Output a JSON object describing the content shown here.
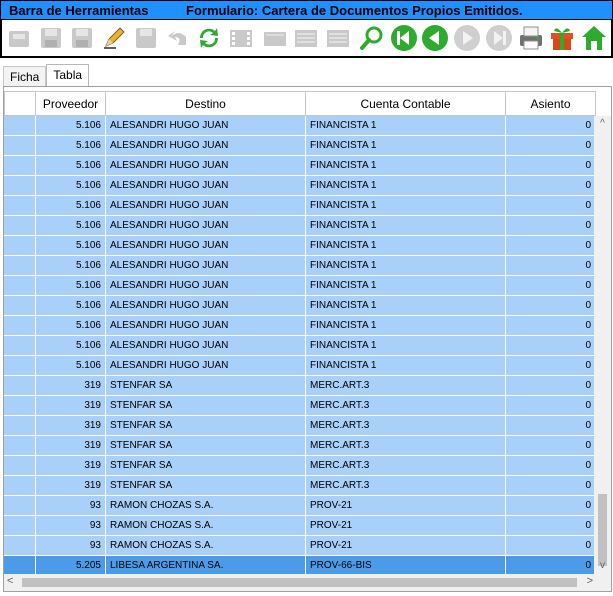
{
  "titlebar": {
    "left": "Barra de Herramientas",
    "right": "Formulario: Cartera de Documentos Propios Emitidos."
  },
  "toolbar": {
    "buttons": [
      {
        "icon": "new-icon",
        "enabled": false
      },
      {
        "icon": "save-icon",
        "enabled": false
      },
      {
        "icon": "save-as-icon",
        "enabled": false
      },
      {
        "icon": "edit-pencil-icon",
        "enabled": true
      },
      {
        "icon": "save-copy-icon",
        "enabled": false
      },
      {
        "icon": "undo-icon",
        "enabled": false
      },
      {
        "icon": "refresh-icon",
        "enabled": true
      },
      {
        "icon": "film-icon",
        "enabled": false
      },
      {
        "icon": "card-icon",
        "enabled": false
      },
      {
        "icon": "list-icon",
        "enabled": false
      },
      {
        "icon": "list2-icon",
        "enabled": false
      },
      {
        "icon": "search-icon",
        "enabled": true
      },
      {
        "icon": "first-record-icon",
        "enabled": true
      },
      {
        "icon": "previous-record-icon",
        "enabled": true
      },
      {
        "icon": "next-record-icon",
        "enabled": false
      },
      {
        "icon": "last-record-icon",
        "enabled": false
      },
      {
        "icon": "print-icon",
        "enabled": true
      },
      {
        "icon": "gift-icon",
        "enabled": true
      },
      {
        "icon": "home-icon",
        "enabled": true
      }
    ]
  },
  "tabs": [
    {
      "label": "Ficha",
      "active": false
    },
    {
      "label": "Tabla",
      "active": true
    }
  ],
  "table": {
    "columns": [
      "",
      "Proveedor",
      "Destino",
      "Cuenta Contable",
      "Asiento"
    ],
    "rows": [
      [
        "5.106",
        "ALESANDRI HUGO JUAN",
        "FINANCISTA 1",
        "0"
      ],
      [
        "5.106",
        "ALESANDRI HUGO JUAN",
        "FINANCISTA 1",
        "0"
      ],
      [
        "5.106",
        "ALESANDRI HUGO JUAN",
        "FINANCISTA 1",
        "0"
      ],
      [
        "5.106",
        "ALESANDRI HUGO JUAN",
        "FINANCISTA 1",
        "0"
      ],
      [
        "5.106",
        "ALESANDRI HUGO JUAN",
        "FINANCISTA 1",
        "0"
      ],
      [
        "5.106",
        "ALESANDRI HUGO JUAN",
        "FINANCISTA 1",
        "0"
      ],
      [
        "5.106",
        "ALESANDRI HUGO JUAN",
        "FINANCISTA 1",
        "0"
      ],
      [
        "5.106",
        "ALESANDRI HUGO JUAN",
        "FINANCISTA 1",
        "0"
      ],
      [
        "5.106",
        "ALESANDRI HUGO JUAN",
        "FINANCISTA 1",
        "0"
      ],
      [
        "5.106",
        "ALESANDRI HUGO JUAN",
        "FINANCISTA 1",
        "0"
      ],
      [
        "5.106",
        "ALESANDRI HUGO JUAN",
        "FINANCISTA 1",
        "0"
      ],
      [
        "5.106",
        "ALESANDRI HUGO JUAN",
        "FINANCISTA 1",
        "0"
      ],
      [
        "5.106",
        "ALESANDRI HUGO JUAN",
        "FINANCISTA 1",
        "0"
      ],
      [
        "319",
        "STENFAR SA",
        "MERC.ART.3",
        "0"
      ],
      [
        "319",
        "STENFAR SA",
        "MERC.ART.3",
        "0"
      ],
      [
        "319",
        "STENFAR SA",
        "MERC.ART.3",
        "0"
      ],
      [
        "319",
        "STENFAR SA",
        "MERC.ART.3",
        "0"
      ],
      [
        "319",
        "STENFAR SA",
        "MERC.ART.3",
        "0"
      ],
      [
        "319",
        "STENFAR SA",
        "MERC.ART.3",
        "0"
      ],
      [
        "93",
        "RAMON CHOZAS S.A.",
        "PROV-21",
        "0"
      ],
      [
        "93",
        "RAMON CHOZAS S.A.",
        "PROV-21",
        "0"
      ],
      [
        "93",
        "RAMON CHOZAS S.A.",
        "PROV-21",
        "0"
      ],
      [
        "5.205",
        "LIBESA ARGENTINA SA.",
        "PROV-66-BIS",
        "0"
      ]
    ],
    "selected_row": 22
  },
  "colors": {
    "titlebar": "#1e90ff",
    "row": "#a8d0f8",
    "selected_row": "#4b9be8",
    "green_icon": "#2eaa2e"
  },
  "scrollbar": {
    "up": "^",
    "down": "v",
    "left": "<",
    "right": ">"
  }
}
